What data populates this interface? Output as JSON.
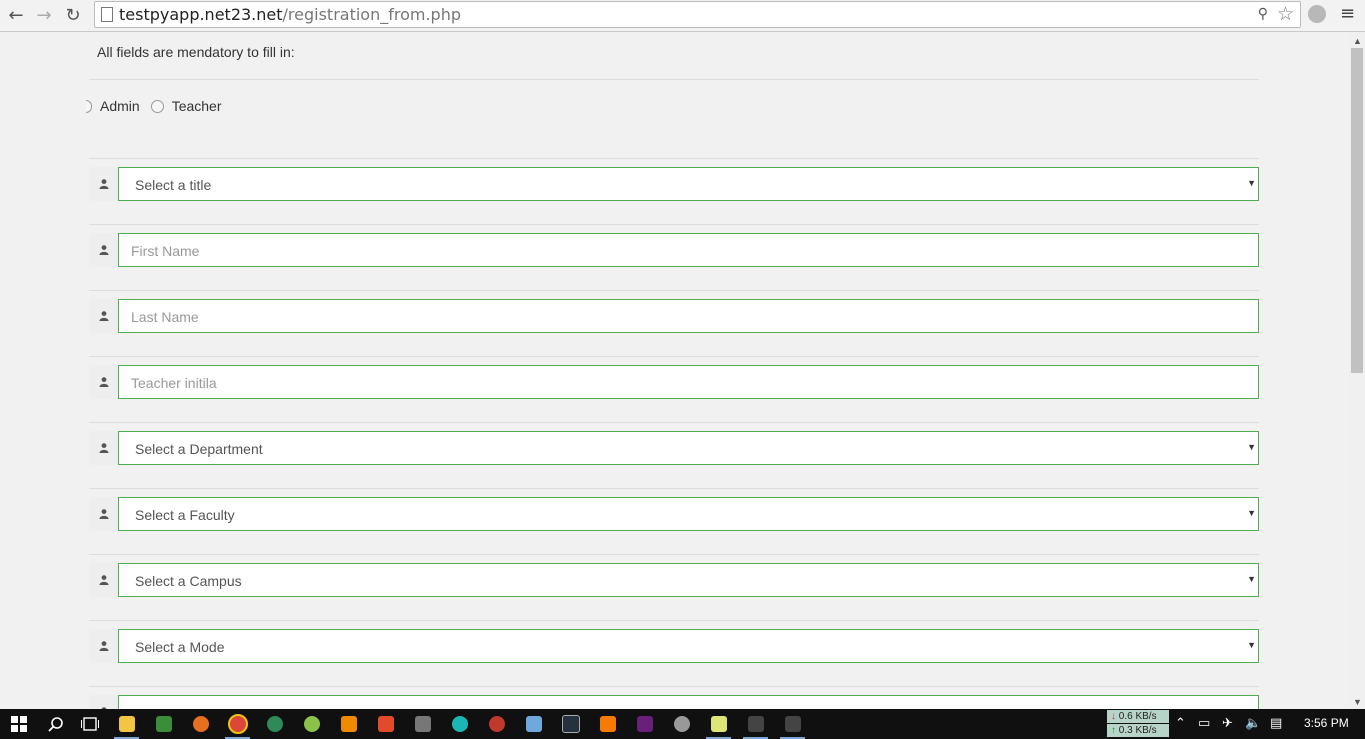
{
  "browser": {
    "url_host": "testpyapp.net23.net",
    "url_path": "/registration_from.php"
  },
  "form": {
    "notice": "All fields are mendatory to fill in:",
    "roles": [
      "Admin",
      "Teacher"
    ],
    "fields": {
      "title": "Select a title",
      "first_name": "First Name",
      "last_name": "Last Name",
      "teacher_initial": "Teacher initila",
      "department": "Select a Department",
      "faculty": "Select a Faculty",
      "campus": "Select a Campus",
      "mode": "Select a Mode"
    }
  },
  "taskbar": {
    "net_down": "0.6 KB/s",
    "net_up": "0.3 KB/s",
    "clock": "3:56 PM"
  }
}
